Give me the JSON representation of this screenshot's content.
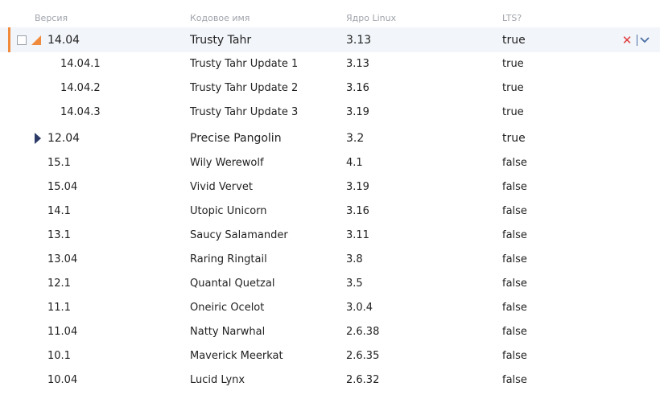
{
  "columns": {
    "version": "Версия",
    "codename": "Кодовое имя",
    "kernel": "Ядро Linux",
    "lts": "LTS?"
  },
  "rows": [
    {
      "version": "14.04",
      "codename": "Trusty Tahr",
      "kernel": "3.13",
      "lts": "true"
    },
    {
      "version": "14.04.1",
      "codename": "Trusty Tahr Update 1",
      "kernel": "3.13",
      "lts": "true"
    },
    {
      "version": "14.04.2",
      "codename": "Trusty Tahr Update 2",
      "kernel": "3.16",
      "lts": "true"
    },
    {
      "version": "14.04.3",
      "codename": "Trusty Tahr Update 3",
      "kernel": "3.19",
      "lts": "true"
    },
    {
      "version": "12.04",
      "codename": "Precise Pangolin",
      "kernel": "3.2",
      "lts": "true"
    },
    {
      "version": "15.1",
      "codename": "Wily Werewolf",
      "kernel": "4.1",
      "lts": "false"
    },
    {
      "version": "15.04",
      "codename": "Vivid Vervet",
      "kernel": "3.19",
      "lts": "false"
    },
    {
      "version": "14.1",
      "codename": "Utopic Unicorn",
      "kernel": "3.16",
      "lts": "false"
    },
    {
      "version": "13.1",
      "codename": "Saucy Salamander",
      "kernel": "3.11",
      "lts": "false"
    },
    {
      "version": "13.04",
      "codename": "Raring Ringtail",
      "kernel": "3.8",
      "lts": "false"
    },
    {
      "version": "12.1",
      "codename": "Quantal Quetzal",
      "kernel": "3.5",
      "lts": "false"
    },
    {
      "version": "11.1",
      "codename": "Oneiric Ocelot",
      "kernel": "3.0.4",
      "lts": "false"
    },
    {
      "version": "11.04",
      "codename": "Natty Narwhal",
      "kernel": "2.6.38",
      "lts": "false"
    },
    {
      "version": "10.1",
      "codename": "Maverick Meerkat",
      "kernel": "2.6.35",
      "lts": "false"
    },
    {
      "version": "10.04",
      "codename": "Lucid Lynx",
      "kernel": "2.6.32",
      "lts": "false"
    }
  ],
  "icons": {
    "expanded": "expanded-triangle-icon",
    "collapsed": "collapsed-triangle-icon",
    "close": "close-icon",
    "menu": "chevron-down-icon"
  },
  "colors": {
    "accent": "#f08a3c",
    "collapsed_marker": "#2b3a67",
    "close": "#e03b3b",
    "menu": "#4a6fa5"
  }
}
